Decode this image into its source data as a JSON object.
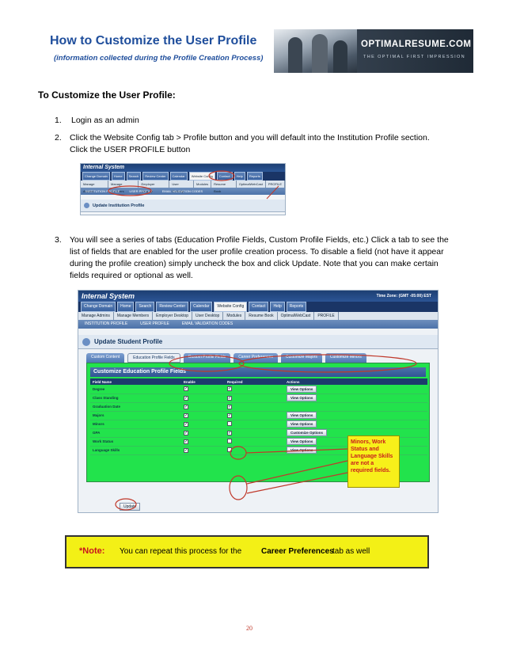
{
  "header": {
    "title": "How to Customize the User Profile",
    "subtitle": "(information collected during the Profile Creation Process)",
    "logo_brand": "OPTIMALRESUME.COM",
    "logo_tagline": "THE OPTIMAL FIRST IMPRESSION"
  },
  "section_title": "To Customize the User Profile:",
  "steps": [
    {
      "num": "1.",
      "lines": [
        "Login as an admin"
      ]
    },
    {
      "num": "2.",
      "lines": [
        "Click the  Website Config tab > Profile button and you will default into the Institution Profile section.",
        "Click the USER PROFILE button"
      ]
    },
    {
      "num": "3.",
      "lines": [
        "You will see a series of tabs (Education Profile Fields, Custom Profile Fields, etc.)  Click a tab to see the",
        "list of fields that are enabled for the user profile creation process.  To disable a field (not have it appear",
        "during the profile creation) simply uncheck the box and click Update.  Note that you can make certain",
        "fields required or optional as well."
      ]
    }
  ],
  "screenshot1": {
    "banner": "Internal System",
    "tabs": [
      "Change Domain",
      "Home",
      "Search",
      "Review Center",
      "Calendar",
      "Website Config",
      "Contact",
      "Help",
      "Reports"
    ],
    "selected_tab": "Website Config",
    "subnav": [
      "Manage Admins",
      "Manage Members",
      "Employer Desktop",
      "User Desktop",
      "Modules",
      "Resume Book",
      "OptimalWebCast",
      "PROFILE"
    ],
    "subtabs": [
      "INSTITUTION PROFILE",
      "USER PROFILE",
      "EMAIL VALIDATION CODES"
    ],
    "panel_title": "Update Institution Profile"
  },
  "screenshot2": {
    "banner": "Internal System",
    "timezone": "Time Zone: (GMT -05:00) EST",
    "tabs": [
      "Change Domain",
      "Home",
      "Search",
      "Review Center",
      "Calendar",
      "Website Config",
      "Contact",
      "Help",
      "Reports"
    ],
    "selected_tab": "Website Config",
    "subnav": [
      "Manage Admins",
      "Manage Members",
      "Employer Desktop",
      "User Desktop",
      "Modules",
      "Resume Book",
      "OptimalWebCast",
      "PROFILE"
    ],
    "subtabs": [
      "INSTITUTION PROFILE",
      "USER PROFILE",
      "EMAIL VALIDATION CODES"
    ],
    "panel_title": "Update Student Profile",
    "profile_tabs": [
      "Custom Content",
      "Education Profile Fields",
      "Custom Profile Fields",
      "Career Preferences",
      "Customize Majors",
      "Customize Minors"
    ],
    "selected_profile_tab": "Education Profile Fields",
    "box_title": "Customize Education Profile Fields",
    "columns": [
      "Field Name",
      "Enable",
      "Required",
      "Actions"
    ],
    "rows": [
      {
        "name": "Degree",
        "enable": true,
        "required": true,
        "action": "View Options"
      },
      {
        "name": "Class Standing",
        "enable": true,
        "required": true,
        "action": "View Options"
      },
      {
        "name": "Graduation Date",
        "enable": true,
        "required": true,
        "action": ""
      },
      {
        "name": "Majors",
        "enable": true,
        "required": true,
        "action": "View Options"
      },
      {
        "name": "Minors",
        "enable": true,
        "required": false,
        "action": "View Options"
      },
      {
        "name": "GPA",
        "enable": true,
        "required": true,
        "action": "Customize Options"
      },
      {
        "name": "Work Status",
        "enable": true,
        "required": false,
        "action": "View Options"
      },
      {
        "name": "Language Skills",
        "enable": true,
        "required": false,
        "action": "View Options"
      }
    ],
    "update_button": "Update",
    "callout_text": "Minors, Work Status and Language Skills are not a required fields."
  },
  "note": {
    "label": "*Note:",
    "text": "You can repeat this process for the",
    "bold": "Career Preferences",
    "tail": "tab as well"
  },
  "page_number": "20",
  "colors": {
    "title_blue": "#1f4e9c",
    "note_fill": "#f3f016",
    "note_label": "#c8141e",
    "table_green": "#22e34c",
    "annotation_red": "#c0392b"
  }
}
